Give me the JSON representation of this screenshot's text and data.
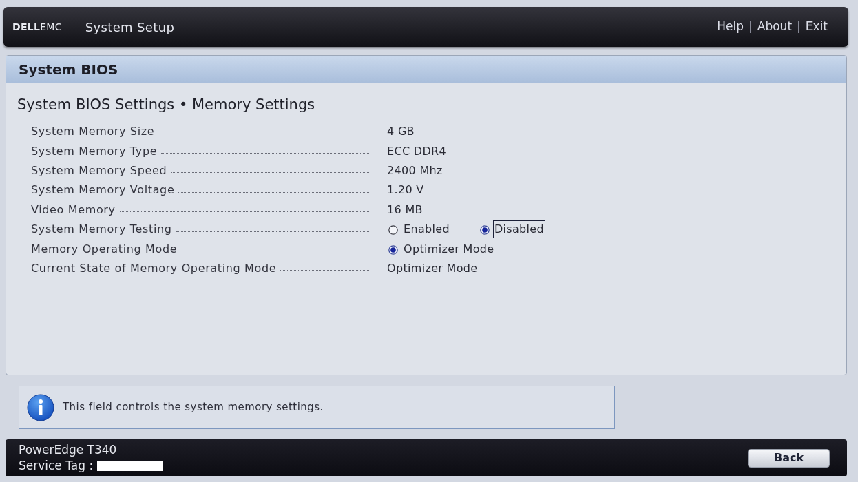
{
  "header": {
    "logo": "**DELL**EMC",
    "title": "System Setup",
    "nav": [
      {
        "kind": "link",
        "text": "Help"
      },
      {
        "kind": "separator",
        "text": "|"
      },
      {
        "kind": "link",
        "text": "About"
      },
      {
        "kind": "separator",
        "text": "|"
      },
      {
        "kind": "link",
        "text": "Exit"
      }
    ]
  },
  "panel": {
    "title": "System BIOS",
    "subtitle": "System BIOS Settings • Memory Settings",
    "settings": [
      {
        "label": "System Memory Size",
        "kind": "text",
        "value": "4 GB"
      },
      {
        "label": "System Memory Type",
        "kind": "text",
        "value": "ECC DDR4"
      },
      {
        "label": "System Memory Speed",
        "kind": "text",
        "value": "2400 Mhz"
      },
      {
        "label": "System Memory Voltage",
        "kind": "text",
        "value": "1.20 V"
      },
      {
        "label": "Video Memory",
        "kind": "text",
        "value": "16 MB"
      },
      {
        "label": "System Memory Testing",
        "kind": "radio",
        "options": [
          {
            "label": "Enabled",
            "selected": false,
            "focused": false
          },
          {
            "label": "Disabled",
            "selected": true,
            "focused": true
          }
        ]
      },
      {
        "label": "Memory Operating Mode",
        "kind": "radio",
        "options": [
          {
            "label": "Optimizer Mode",
            "selected": true,
            "focused": false
          }
        ]
      },
      {
        "label": "Current State of Memory Operating Mode",
        "kind": "text",
        "value": "Optimizer Mode"
      }
    ]
  },
  "help": {
    "text": "This field controls the system memory settings."
  },
  "footer": {
    "model": "PowerEdge T340",
    "service_tag_label": "Service Tag :",
    "back_button": "Back"
  }
}
